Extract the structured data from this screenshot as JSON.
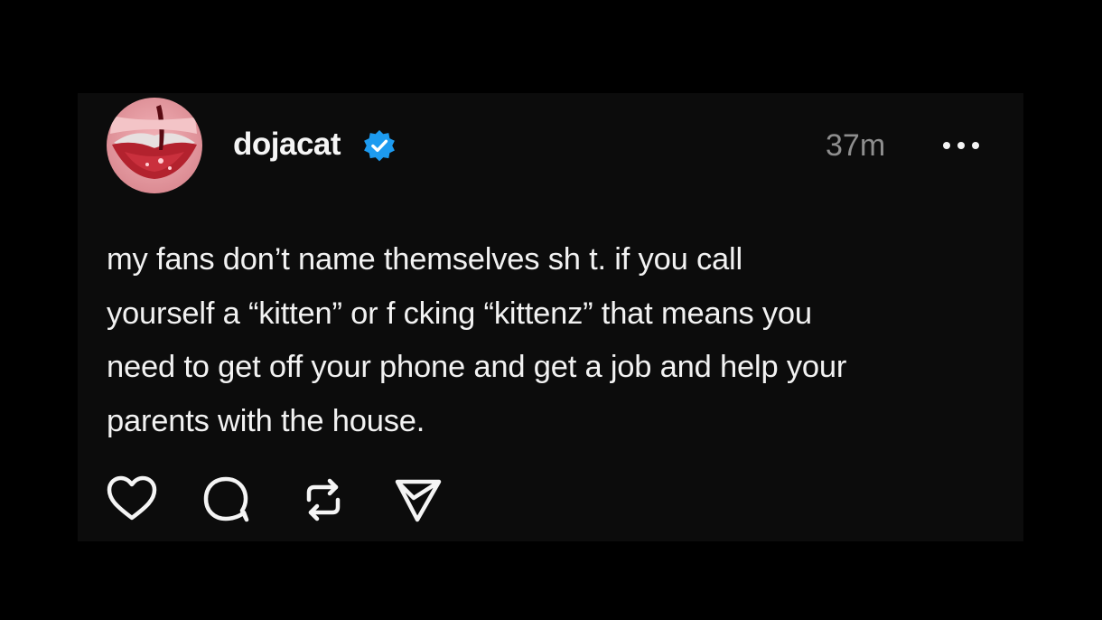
{
  "post": {
    "username": "dojacat",
    "verified": true,
    "timestamp": "37m",
    "text_lines": [
      "my fans don’t name themselves sh t. if you call",
      "yourself a “kitten” or f  cking “kittenz” that means you",
      "need to get off your phone and get a job and help your",
      "parents with the house."
    ]
  },
  "icons": {
    "verified": "verified-badge-icon",
    "more": "more-options-icon",
    "like": "heart-icon",
    "reply": "comment-icon",
    "repost": "repost-icon",
    "share": "send-icon"
  },
  "colors": {
    "background": "#000000",
    "card": "#0c0c0c",
    "text": "#f2f2f2",
    "muted": "#8e8e8e",
    "verified": "#1d9bf0"
  }
}
